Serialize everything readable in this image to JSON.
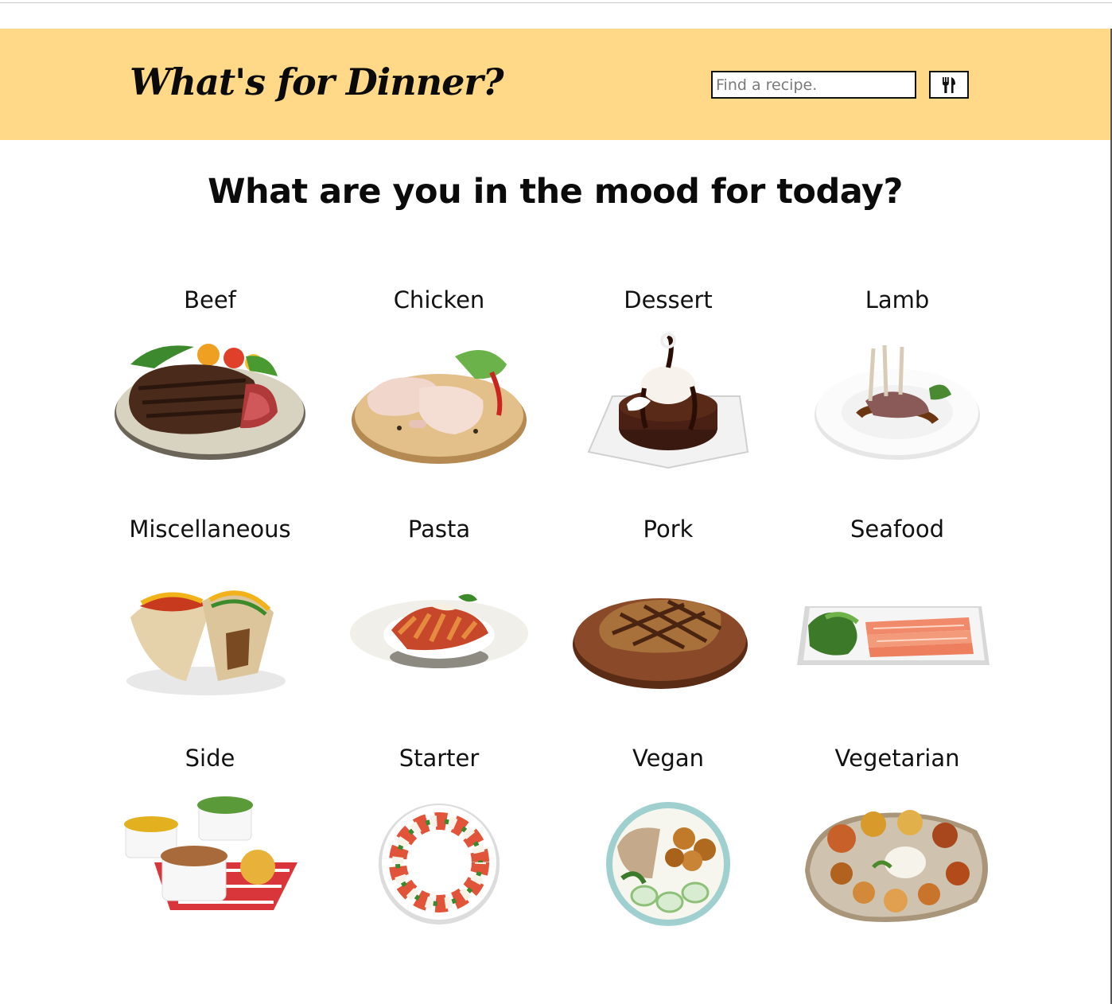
{
  "header": {
    "title": "What's for Dinner?",
    "search": {
      "placeholder": "Find a recipe.",
      "value": ""
    },
    "search_button_icon": "utensils-icon",
    "background": "#ffd987"
  },
  "main": {
    "heading": "What are you in the mood for today?"
  },
  "categories": [
    {
      "label": "Beef",
      "icon": "steak-plate-image"
    },
    {
      "label": "Chicken",
      "icon": "chicken-legs-image"
    },
    {
      "label": "Dessert",
      "icon": "chocolate-cake-image"
    },
    {
      "label": "Lamb",
      "icon": "lamb-rack-image"
    },
    {
      "label": "Miscellaneous",
      "icon": "tacos-image"
    },
    {
      "label": "Pasta",
      "icon": "penne-pasta-image"
    },
    {
      "label": "Pork",
      "icon": "pork-chop-image"
    },
    {
      "label": "Seafood",
      "icon": "salmon-platter-image"
    },
    {
      "label": "Side",
      "icon": "side-bowls-image"
    },
    {
      "label": "Starter",
      "icon": "caprese-salad-image"
    },
    {
      "label": "Vegan",
      "icon": "vegan-bowl-image"
    },
    {
      "label": "Vegetarian",
      "icon": "thali-platter-image"
    }
  ]
}
